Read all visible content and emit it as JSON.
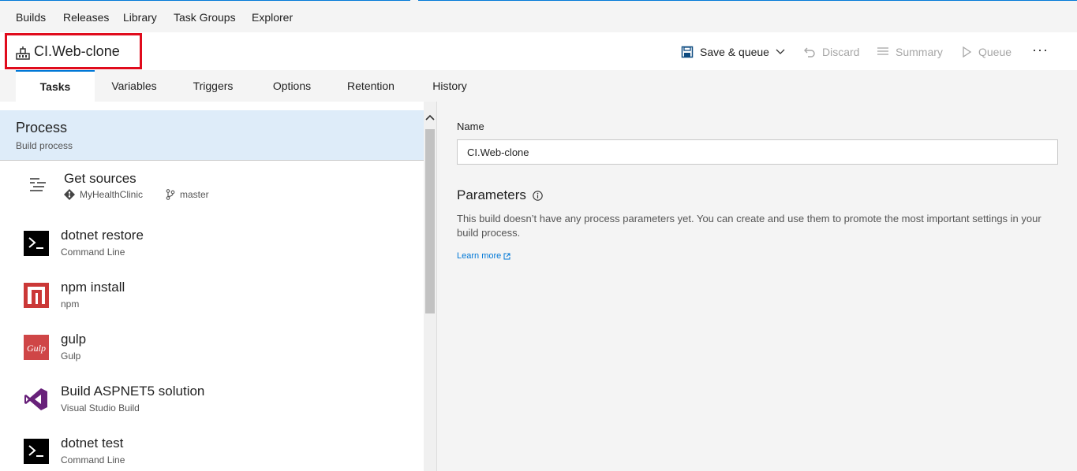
{
  "hub_nav": {
    "items": [
      "Builds",
      "Releases",
      "Library",
      "Task Groups",
      "Explorer"
    ]
  },
  "header": {
    "title": "CI.Web-clone",
    "title_icon": "build-pipeline-icon"
  },
  "toolbar": {
    "save_queue": "Save & queue",
    "discard": "Discard",
    "summary": "Summary",
    "queue": "Queue",
    "more": "···"
  },
  "tabs": [
    {
      "label": "Tasks",
      "active": true
    },
    {
      "label": "Variables",
      "active": false
    },
    {
      "label": "Triggers",
      "active": false
    },
    {
      "label": "Options",
      "active": false
    },
    {
      "label": "Retention",
      "active": false
    },
    {
      "label": "History",
      "active": false
    }
  ],
  "process": {
    "title": "Process",
    "subtitle": "Build process"
  },
  "get_sources": {
    "name": "Get sources",
    "repo": "MyHealthClinic",
    "branch": "master"
  },
  "tasks": [
    {
      "name": "dotnet restore",
      "type": "Command Line",
      "icon": "command-line-icon"
    },
    {
      "name": "npm install",
      "type": "npm",
      "icon": "npm-icon"
    },
    {
      "name": "gulp",
      "type": "Gulp",
      "icon": "gulp-icon"
    },
    {
      "name": "Build ASPNET5 solution",
      "type": "Visual Studio Build",
      "icon": "visual-studio-icon"
    },
    {
      "name": "dotnet test",
      "type": "Command Line",
      "icon": "command-line-icon"
    }
  ],
  "details": {
    "name_label": "Name",
    "name_value": "CI.Web-clone",
    "parameters_title": "Parameters",
    "parameters_desc": "This build doesn’t have any process parameters yet. You can create and use them to promote the most important settings in your build process.",
    "learn_more": "Learn more"
  },
  "colors": {
    "accent": "#0078d7",
    "highlight_box": "#e00b1c",
    "selected_row": "#deecf9",
    "npm_red": "#cb3837",
    "gulp_red": "#cf4647",
    "vs_purple": "#68217a"
  }
}
